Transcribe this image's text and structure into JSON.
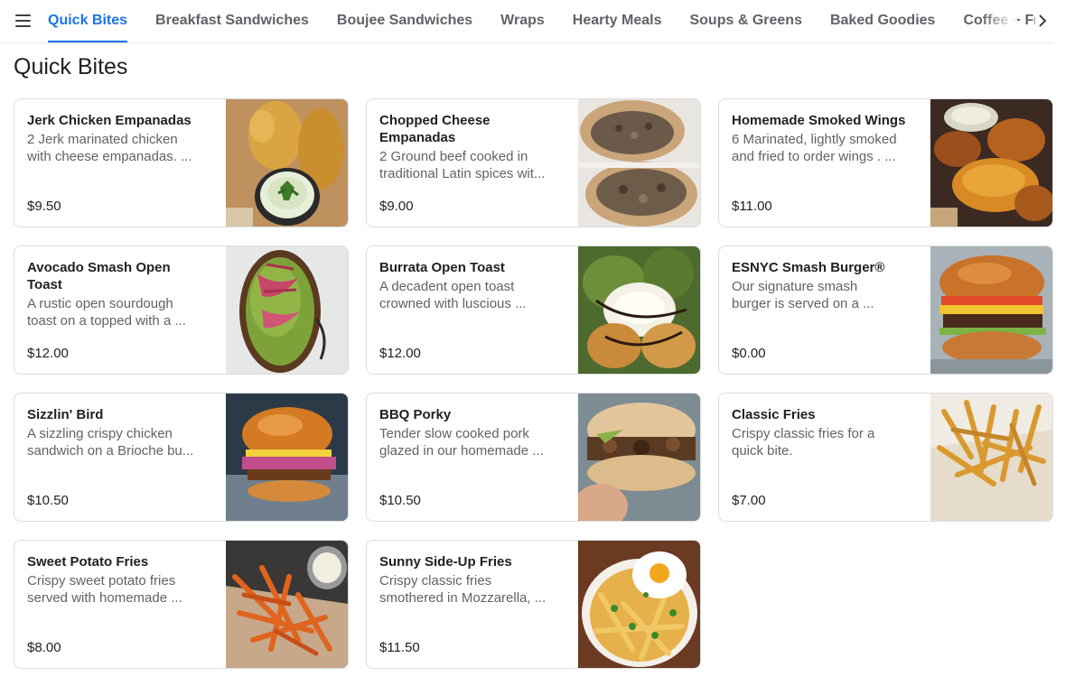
{
  "nav": {
    "tabs": [
      "Quick Bites",
      "Breakfast Sandwiches",
      "Boujee Sandwiches",
      "Wraps",
      "Hearty Meals",
      "Soups & Greens",
      "Baked Goodies",
      "Coffee + Fresh Sq"
    ],
    "active_index": 0,
    "icons": {
      "menu": "hamburger-menu-icon",
      "scroll": "chevron-right-icon"
    },
    "accent_color": "#1a73e8"
  },
  "section": {
    "title": "Quick Bites"
  },
  "items": [
    {
      "name": "Jerk Chicken Empanadas",
      "desc1": "2 Jerk marinated chicken",
      "desc2": "with cheese empanadas. ...",
      "price": "$9.50",
      "image": "empanadas-with-dip"
    },
    {
      "name": "Chopped Cheese",
      "name2": "Empanadas",
      "desc1": "2 Ground beef cooked in",
      "desc2": "traditional Latin spices wit...",
      "price": "$9.00",
      "image": "cut-empanadas"
    },
    {
      "name": "Homemade Smoked Wings",
      "desc1": "6 Marinated, lightly smoked",
      "desc2": "and fried to order wings . ...",
      "price": "$11.00",
      "image": "chicken-wings"
    },
    {
      "name": "Avocado Smash Open",
      "name2": "Toast",
      "desc1": "A rustic open sourdough",
      "desc2": "toast on a topped with a ...",
      "price": "$12.00",
      "image": "avocado-toast"
    },
    {
      "name": "Burrata Open Toast",
      "desc1": "A decadent open toast",
      "desc2": "crowned with luscious ...",
      "price": "$12.00",
      "image": "burrata-toast"
    },
    {
      "name": "ESNYC Smash Burger®",
      "desc1": "Our signature smash",
      "desc2": "burger is served on a ...",
      "price": "$0.00",
      "image": "smash-burger"
    },
    {
      "name": "Sizzlin' Bird",
      "desc1": "A sizzling crispy chicken",
      "desc2": "sandwich on a Brioche bu...",
      "price": "$10.50",
      "image": "chicken-sandwich"
    },
    {
      "name": "BBQ Porky",
      "desc1": "Tender slow cooked pork",
      "desc2": "glazed in our homemade ...",
      "price": "$10.50",
      "image": "pork-sandwich"
    },
    {
      "name": "Classic Fries",
      "desc1": "Crispy classic fries for a",
      "desc2": "quick bite.",
      "price": "$7.00",
      "image": "fries"
    },
    {
      "name": "Sweet Potato Fries",
      "desc1": "Crispy sweet potato fries",
      "desc2": "served with homemade ...",
      "price": "$8.00",
      "image": "sweet-potato-fries"
    },
    {
      "name": "Sunny Side-Up Fries",
      "desc1": "Crispy classic fries",
      "desc2": "smothered in Mozzarella, ...",
      "price": "$11.50",
      "image": "loaded-fries-egg"
    }
  ]
}
